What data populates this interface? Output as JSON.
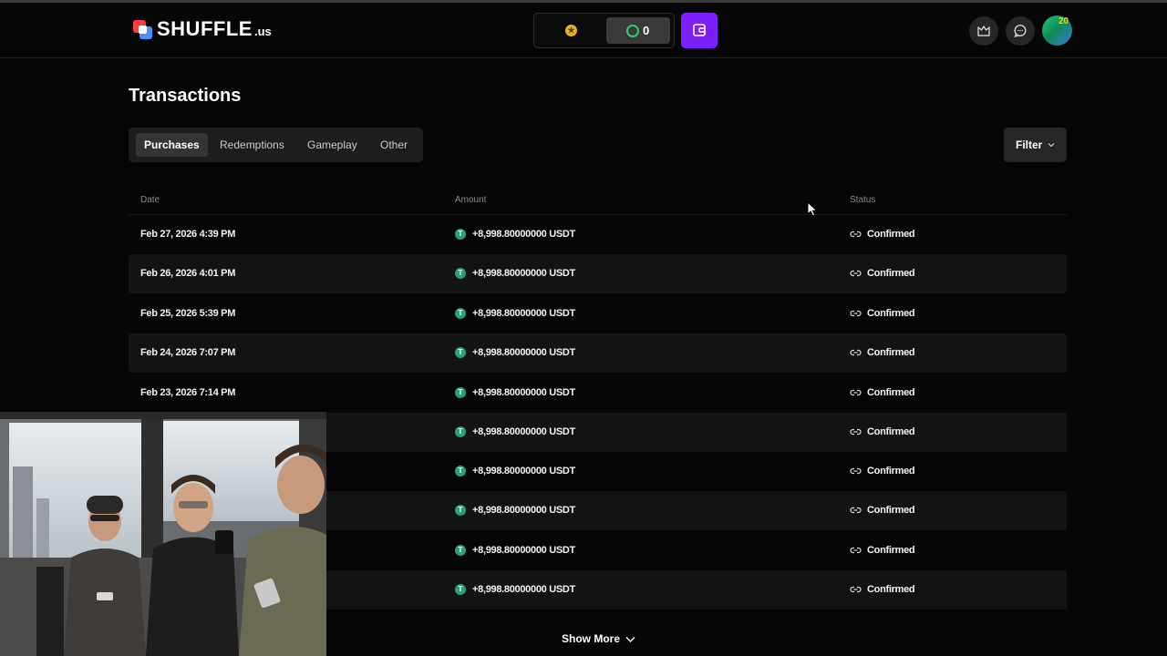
{
  "brand": {
    "name": "SHUFFLE",
    "suffix": ".us"
  },
  "header": {
    "green_balance": "0",
    "gold_coin_icon": "gold-coin-icon",
    "green_coin_icon": "green-coin-icon",
    "notification_badge": "20"
  },
  "page": {
    "title": "Transactions"
  },
  "tabs": [
    {
      "label": "Purchases",
      "active": true
    },
    {
      "label": "Redemptions",
      "active": false
    },
    {
      "label": "Gameplay",
      "active": false
    },
    {
      "label": "Other",
      "active": false
    }
  ],
  "filter": {
    "label": "Filter"
  },
  "table": {
    "headers": {
      "date": "Date",
      "amount": "Amount",
      "status": "Status"
    },
    "rows": [
      {
        "date": "Feb 27, 2026 4:39 PM",
        "amount": "+8,998.80000000",
        "currency": "USDT",
        "status": "Confirmed"
      },
      {
        "date": "Feb 26, 2026 4:01 PM",
        "amount": "+8,998.80000000",
        "currency": "USDT",
        "status": "Confirmed"
      },
      {
        "date": "Feb 25, 2026 5:39 PM",
        "amount": "+8,998.80000000",
        "currency": "USDT",
        "status": "Confirmed"
      },
      {
        "date": "Feb 24, 2026 7:07 PM",
        "amount": "+8,998.80000000",
        "currency": "USDT",
        "status": "Confirmed"
      },
      {
        "date": "Feb 23, 2026 7:14 PM",
        "amount": "+8,998.80000000",
        "currency": "USDT",
        "status": "Confirmed"
      },
      {
        "date": "",
        "amount": "+8,998.80000000",
        "currency": "USDT",
        "status": "Confirmed"
      },
      {
        "date": "",
        "amount": "+8,998.80000000",
        "currency": "USDT",
        "status": "Confirmed"
      },
      {
        "date": "",
        "amount": "+8,998.80000000",
        "currency": "USDT",
        "status": "Confirmed"
      },
      {
        "date": "",
        "amount": "+8,998.80000000",
        "currency": "USDT",
        "status": "Confirmed"
      },
      {
        "date": "",
        "amount": "+8,998.80000000",
        "currency": "USDT",
        "status": "Confirmed"
      }
    ]
  },
  "show_more": {
    "label": "Show More"
  },
  "colors": {
    "accent_purple": "#7b1fff",
    "tether_green": "#26a17b",
    "gold": "#e6b422",
    "badge_yellow": "#f0e000"
  }
}
